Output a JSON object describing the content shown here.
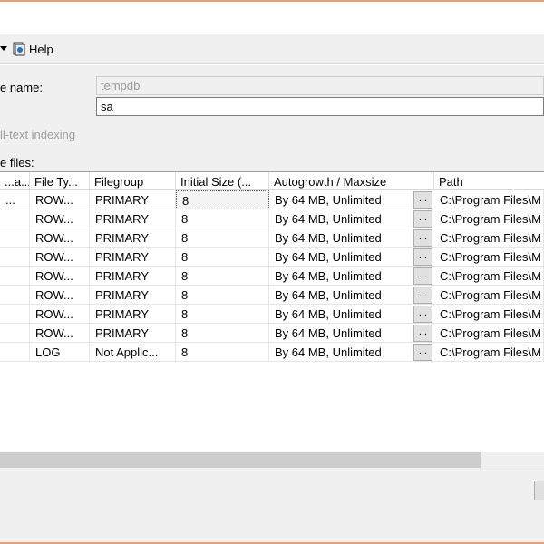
{
  "toolbar": {
    "help_label": "Help",
    "help_icon": "help-icon"
  },
  "form": {
    "database_name_label": "e name:",
    "database_name_value": "tempdb",
    "owner_value": "sa",
    "fulltext_label": "ll-text indexing",
    "database_files_label": "e files:"
  },
  "grid": {
    "columns": [
      "...a...",
      "File Ty...",
      "Filegroup",
      "Initial Size (...",
      "Autogrowth / Maxsize",
      "Path"
    ],
    "rows": [
      {
        "name": "...",
        "file_type": "ROW...",
        "filegroup": "PRIMARY",
        "initial_size": "8",
        "autogrowth": "By 64 MB, Unlimited",
        "path": "C:\\Program Files\\M"
      },
      {
        "name": "",
        "file_type": "ROW...",
        "filegroup": "PRIMARY",
        "initial_size": "8",
        "autogrowth": "By 64 MB, Unlimited",
        "path": "C:\\Program Files\\M"
      },
      {
        "name": "",
        "file_type": "ROW...",
        "filegroup": "PRIMARY",
        "initial_size": "8",
        "autogrowth": "By 64 MB, Unlimited",
        "path": "C:\\Program Files\\M"
      },
      {
        "name": "",
        "file_type": "ROW...",
        "filegroup": "PRIMARY",
        "initial_size": "8",
        "autogrowth": "By 64 MB, Unlimited",
        "path": "C:\\Program Files\\M"
      },
      {
        "name": "",
        "file_type": "ROW...",
        "filegroup": "PRIMARY",
        "initial_size": "8",
        "autogrowth": "By 64 MB, Unlimited",
        "path": "C:\\Program Files\\M"
      },
      {
        "name": "",
        "file_type": "ROW...",
        "filegroup": "PRIMARY",
        "initial_size": "8",
        "autogrowth": "By 64 MB, Unlimited",
        "path": "C:\\Program Files\\M"
      },
      {
        "name": "",
        "file_type": "ROW...",
        "filegroup": "PRIMARY",
        "initial_size": "8",
        "autogrowth": "By 64 MB, Unlimited",
        "path": "C:\\Program Files\\M"
      },
      {
        "name": "",
        "file_type": "ROW...",
        "filegroup": "PRIMARY",
        "initial_size": "8",
        "autogrowth": "By 64 MB, Unlimited",
        "path": "C:\\Program Files\\M"
      },
      {
        "name": "",
        "file_type": "LOG",
        "filegroup": "Not Applic...",
        "initial_size": "8",
        "autogrowth": "By 64 MB, Unlimited",
        "path": "C:\\Program Files\\M"
      }
    ],
    "ellipsis_label": "..."
  },
  "colors": {
    "accent_border": "#e8a070",
    "panel_bg": "#f0f0f0"
  }
}
